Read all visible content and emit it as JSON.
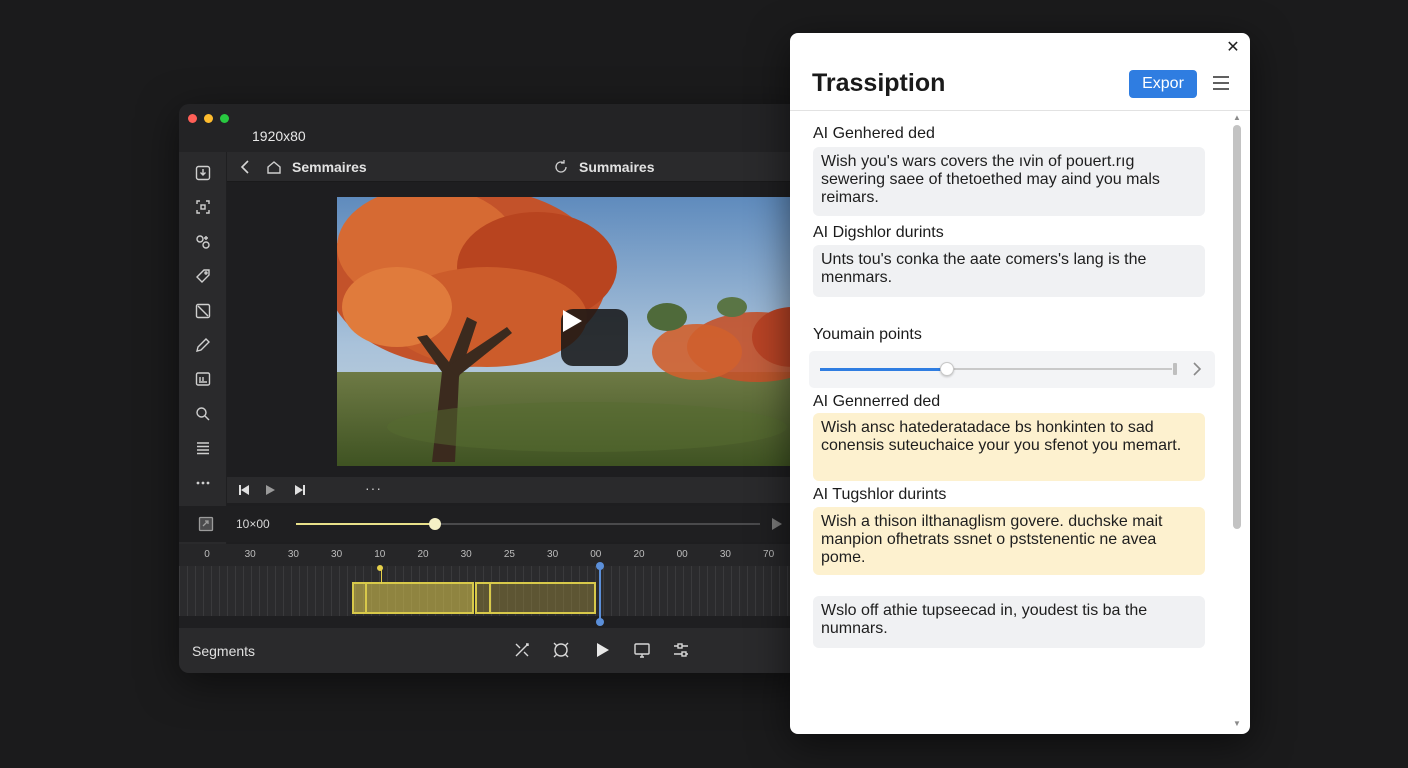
{
  "editor": {
    "window_title": "1920x80",
    "traffic_lights": [
      "#ff5f57",
      "#febc2e",
      "#28c840"
    ],
    "sidebar_tools": [
      "import-icon",
      "crop-icon",
      "effects-icon",
      "tag-icon",
      "transition-icon",
      "pencil-icon",
      "caption-icon",
      "search-icon",
      "list-icon",
      "more-icon"
    ],
    "nav": {
      "crumb": "Semmaires",
      "center": "Summaires"
    },
    "transport": {
      "more": "···"
    },
    "scrub": {
      "time": "10×00",
      "progress": 0.3
    },
    "ruler_ticks": [
      "0",
      "30",
      "30",
      "30",
      "10",
      "20",
      "30",
      "25",
      "30",
      "00",
      "20",
      "00",
      "30",
      "70"
    ],
    "bottom": {
      "label": "Segments"
    }
  },
  "panel": {
    "title": "Trassiption",
    "export_label": "Expor",
    "sections": [
      {
        "title": "AI Genhered ded",
        "style": "gray",
        "text": "Wish you's wars covers the ıvin of pouert.rıg sewering saee of thetoethed may aind you mals reimars."
      },
      {
        "title": "AI Digshlor durints",
        "style": "gray",
        "text": "Unts tou's conka the aate comers's lang is the menmars."
      }
    ],
    "main_points": {
      "title": "Youmain points",
      "value": 0.36
    },
    "sections2": [
      {
        "title": "AI Gennerred ded",
        "style": "yellow",
        "text": "Wish ansc hatederatadace bs honkinten to sad conensis suteuchaice your you sfenot you memart."
      },
      {
        "title": "AI Tugshlor durints",
        "style": "yellow",
        "text": "Wish a thison ilthanaglism govere. duchske mait manpion ofhetrats ssnet o pststenentic ne avea pome."
      }
    ],
    "final_card": {
      "style": "gray",
      "text": "Wslo off athie tupseecad in, youdest tis ba the numnars."
    }
  }
}
